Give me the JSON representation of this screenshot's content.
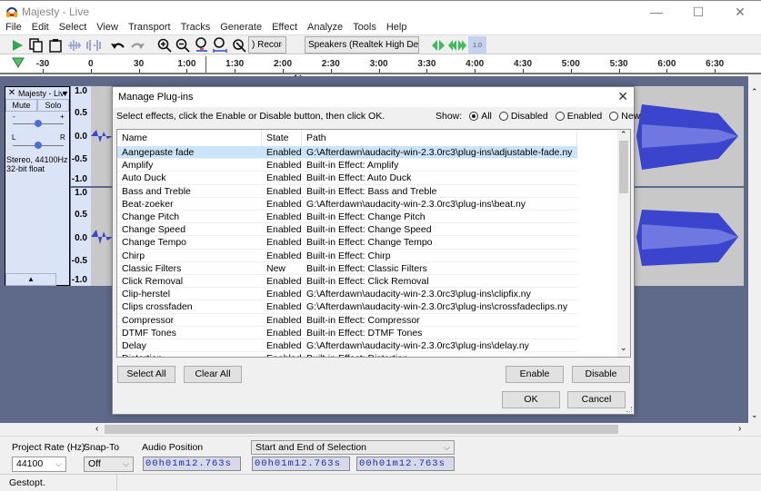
{
  "window": {
    "title": "Majesty - Live",
    "minimize_glyph": "—",
    "maximize_glyph": "☐",
    "close_glyph": "✕"
  },
  "menu": [
    "File",
    "Edit",
    "Select",
    "View",
    "Transport",
    "Tracks",
    "Generate",
    "Effect",
    "Analyze",
    "Tools",
    "Help"
  ],
  "toolbar": {
    "recording_device": ") Recor",
    "playback_device": "Speakers (Realtek High Defi",
    "speed_label": "1.0"
  },
  "ruler": {
    "ticks": [
      "-30",
      "0",
      "30",
      "1:00",
      "1:30",
      "2:00",
      "2:30",
      "3:00",
      "3:30",
      "4:00",
      "4:30",
      "5:00",
      "5:30",
      "6:00",
      "6:30"
    ]
  },
  "track": {
    "name": "Majesty - Liv",
    "mute_label": "Mute",
    "solo_label": "Solo",
    "gain_minus": "-",
    "gain_plus": "+",
    "pan_left": "L",
    "pan_right": "R",
    "info_line1": "Stereo, 44100Hz",
    "info_line2": "32-bit float",
    "scale_labels": [
      "1.0",
      "0.5",
      "0.0",
      "-0.5",
      "-1.0"
    ]
  },
  "dialog": {
    "title": "Manage Plug-ins",
    "close_glyph": "✕",
    "instructions": "Select effects, click the Enable or Disable button, then click OK.",
    "show_label": "Show:",
    "filters": [
      {
        "label": "All",
        "selected": true
      },
      {
        "label": "Disabled",
        "selected": false
      },
      {
        "label": "Enabled",
        "selected": false
      },
      {
        "label": "New",
        "selected": false
      }
    ],
    "columns": [
      "Name",
      "State",
      "Path"
    ],
    "rows": [
      {
        "name": "Aangepaste fade",
        "state": "Enabled",
        "path": "G:\\Afterdawn\\audacity-win-2.3.0rc3\\plug-ins\\adjustable-fade.ny",
        "selected": true
      },
      {
        "name": "Amplify",
        "state": "Enabled",
        "path": "Built-in Effect: Amplify"
      },
      {
        "name": "Auto Duck",
        "state": "Enabled",
        "path": "Built-in Effect: Auto Duck"
      },
      {
        "name": "Bass and Treble",
        "state": "Enabled",
        "path": "Built-in Effect: Bass and Treble"
      },
      {
        "name": "Beat-zoeker",
        "state": "Enabled",
        "path": "G:\\Afterdawn\\audacity-win-2.3.0rc3\\plug-ins\\beat.ny"
      },
      {
        "name": "Change Pitch",
        "state": "Enabled",
        "path": "Built-in Effect: Change Pitch"
      },
      {
        "name": "Change Speed",
        "state": "Enabled",
        "path": "Built-in Effect: Change Speed"
      },
      {
        "name": "Change Tempo",
        "state": "Enabled",
        "path": "Built-in Effect: Change Tempo"
      },
      {
        "name": "Chirp",
        "state": "Enabled",
        "path": "Built-in Effect: Chirp"
      },
      {
        "name": "Classic Filters",
        "state": "New",
        "path": "Built-in Effect: Classic Filters"
      },
      {
        "name": "Click Removal",
        "state": "Enabled",
        "path": "Built-in Effect: Click Removal"
      },
      {
        "name": "Clip-herstel",
        "state": "Enabled",
        "path": "G:\\Afterdawn\\audacity-win-2.3.0rc3\\plug-ins\\clipfix.ny"
      },
      {
        "name": "Clips crossfaden",
        "state": "Enabled",
        "path": "G:\\Afterdawn\\audacity-win-2.3.0rc3\\plug-ins\\crossfadeclips.ny"
      },
      {
        "name": "Compressor",
        "state": "Enabled",
        "path": "Built-in Effect: Compressor"
      },
      {
        "name": "DTMF Tones",
        "state": "Enabled",
        "path": "Built-in Effect: DTMF Tones"
      },
      {
        "name": "Delay",
        "state": "Enabled",
        "path": "G:\\Afterdawn\\audacity-win-2.3.0rc3\\plug-ins\\delay.ny"
      },
      {
        "name": "Distortion",
        "state": "Enabled",
        "path": "Built-in Effect: Distortion"
      }
    ],
    "buttons": {
      "select_all": "Select All",
      "clear_all": "Clear All",
      "enable": "Enable",
      "disable": "Disable",
      "ok": "OK",
      "cancel": "Cancel"
    }
  },
  "selection_bar": {
    "project_rate_label": "Project Rate (Hz)",
    "project_rate_value": "44100",
    "snap_to_label": "Snap-To",
    "snap_to_value": "Off",
    "audio_position_label": "Audio Position",
    "audio_position_value": "00h01m12.763s",
    "selection_mode": "Start and End of Selection",
    "selection_start": "00h01m12.763s",
    "selection_end": "00h01m12.763s"
  },
  "status": {
    "text": "Gestopt."
  }
}
